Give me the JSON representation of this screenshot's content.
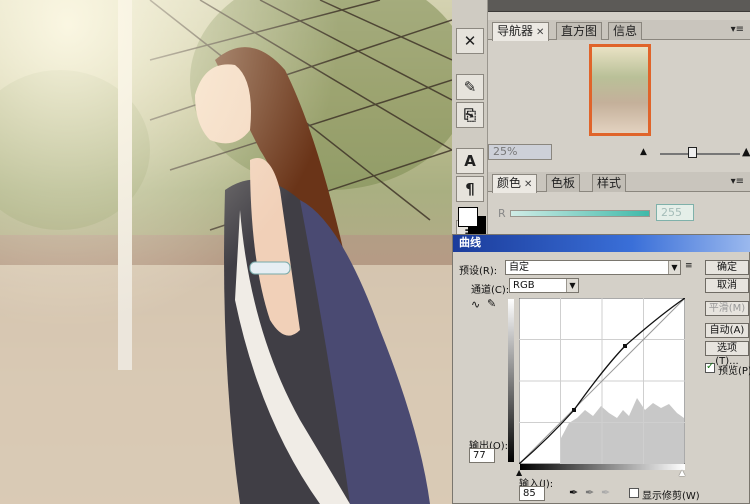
{
  "navigator_panel": {
    "tabs": [
      "导航器",
      "直方图",
      "信息"
    ],
    "zoom": "25%"
  },
  "color_panel": {
    "tabs": [
      "颜色",
      "色板",
      "样式"
    ],
    "channel_label": "R",
    "channel_value": "255"
  },
  "curves_dialog": {
    "title": "曲线",
    "preset_label": "预设(R):",
    "preset_value": "自定",
    "channel_label": "通道(C):",
    "channel_value": "RGB",
    "output_label": "输出(O):",
    "output_value": "77",
    "input_label": "输入(I):",
    "input_value": "85",
    "show_clipping_label": "显示修剪(W)",
    "buttons": {
      "ok": "确定",
      "cancel": "取消",
      "smooth": "平滑(M)",
      "auto": "自动(A)",
      "options": "选项(T)..."
    },
    "preview_label": "预览(P)",
    "preview_checked": true
  },
  "colors": {
    "curves_title_bar": "#1b3c9b",
    "nav_view_box": "#e0642a",
    "channel_slider": "#3fb9a9"
  }
}
